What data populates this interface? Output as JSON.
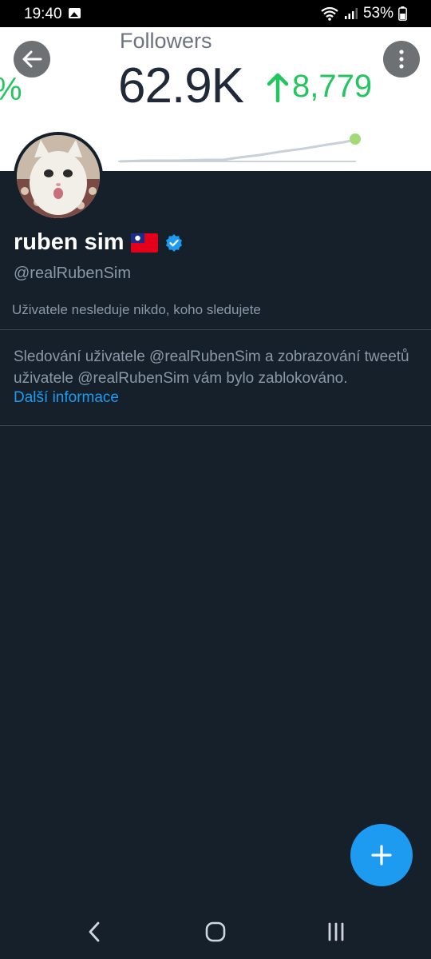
{
  "status_bar": {
    "time": "19:40",
    "battery": "53%"
  },
  "banner": {
    "label": "Followers",
    "total": "62.9K",
    "delta": "8,779",
    "left_fragment": "%",
    "accent": "#22c55e"
  },
  "profile": {
    "name": "ruben sim",
    "handle": "@realRubenSim",
    "follow_note": "Uživatele nesleduje nikdo, koho sledujete",
    "verified_color": "#1d9bf0"
  },
  "blocked": {
    "message": "Sledování uživatele @realRubenSim a zobrazování tweetů uživatele @realRubenSim vám bylo zablokováno.",
    "link": "Další informace"
  },
  "icons": {
    "back": "arrow-left-icon",
    "more": "more-vertical-icon",
    "compose": "plus-icon",
    "nav_back": "chevron-left-icon",
    "nav_home": "home-circle-icon",
    "nav_recents": "recents-icon"
  }
}
